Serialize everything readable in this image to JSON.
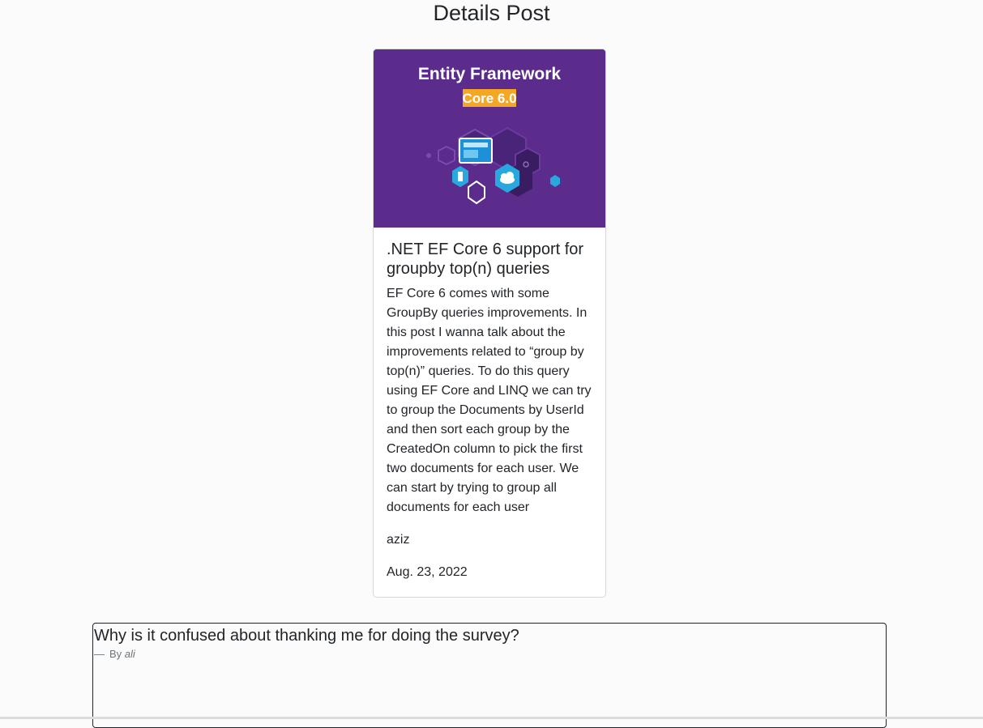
{
  "page": {
    "title": "Details Post"
  },
  "post": {
    "image": {
      "heading": "Entity Framework",
      "badge": "Core 6.0",
      "colors": {
        "background": "#5b2c8c",
        "badge": "#f5a623",
        "hex_blue": "#29a8e0",
        "hex_light": "#6fc8f0"
      }
    },
    "title": ".NET EF Core 6 support for groupby top(n) queries",
    "body": "EF Core 6 comes with some GroupBy queries improvements. In this post I wanna talk about the improvements related to “group by top(n)” queries. To do this query using EF Core and LINQ we can try to group the Documents by UserId and then sort each group by the CreatedOn column to pick the first two documents for each user. We can start by trying to group all documents for each user",
    "author": "aziz",
    "date": "Aug. 23, 2022"
  },
  "comment": {
    "text": "Why is it confused about thanking me for doing the survey?",
    "by_label": "By",
    "author": "ali"
  }
}
